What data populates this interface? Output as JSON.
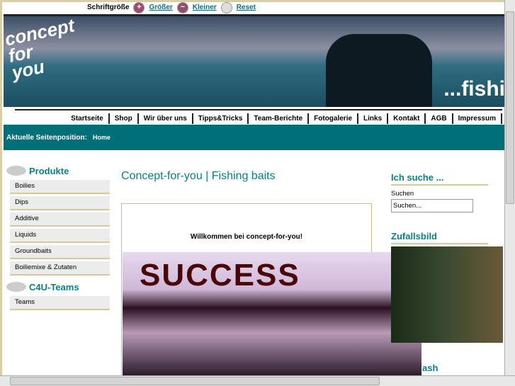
{
  "fontsize": {
    "label": "Schriftgröße",
    "bigger": "Größer",
    "smaller": "Kleiner",
    "reset": "Reset"
  },
  "banner": {
    "logo": "concept for you",
    "tagline": "...fishi"
  },
  "nav": [
    "Startseite",
    "Shop",
    "Wir über uns",
    "Tipps&Tricks",
    "Team-Berichte",
    "Fotogalerie",
    "Links",
    "Kontakt",
    "AGB",
    "Impressum"
  ],
  "breadcrumb": {
    "label": "Aktuelle Seitenposition:",
    "current": "Home"
  },
  "sidebar": {
    "products_heading": "Produkte",
    "products": [
      "Boilies",
      "Dips",
      "Additive",
      "Liquids",
      "Groundbaits",
      "Boiliemixe & Zutaten"
    ],
    "teams_heading": "C4U-Teams",
    "teams": [
      "Teams"
    ]
  },
  "main": {
    "title": "Concept-for-you | Fishing baits",
    "welcome": "Willkommen bei concept-for-you!",
    "banner_text": "SUCCESS"
  },
  "right": {
    "search_heading": "Ich suche ...",
    "search_label": "Suchen",
    "search_value": "Suchen...",
    "random_heading": "Zufallsbild",
    "flash_heading": "ash"
  },
  "colors": {
    "accent": "#006f78",
    "border": "#d6c99a"
  }
}
